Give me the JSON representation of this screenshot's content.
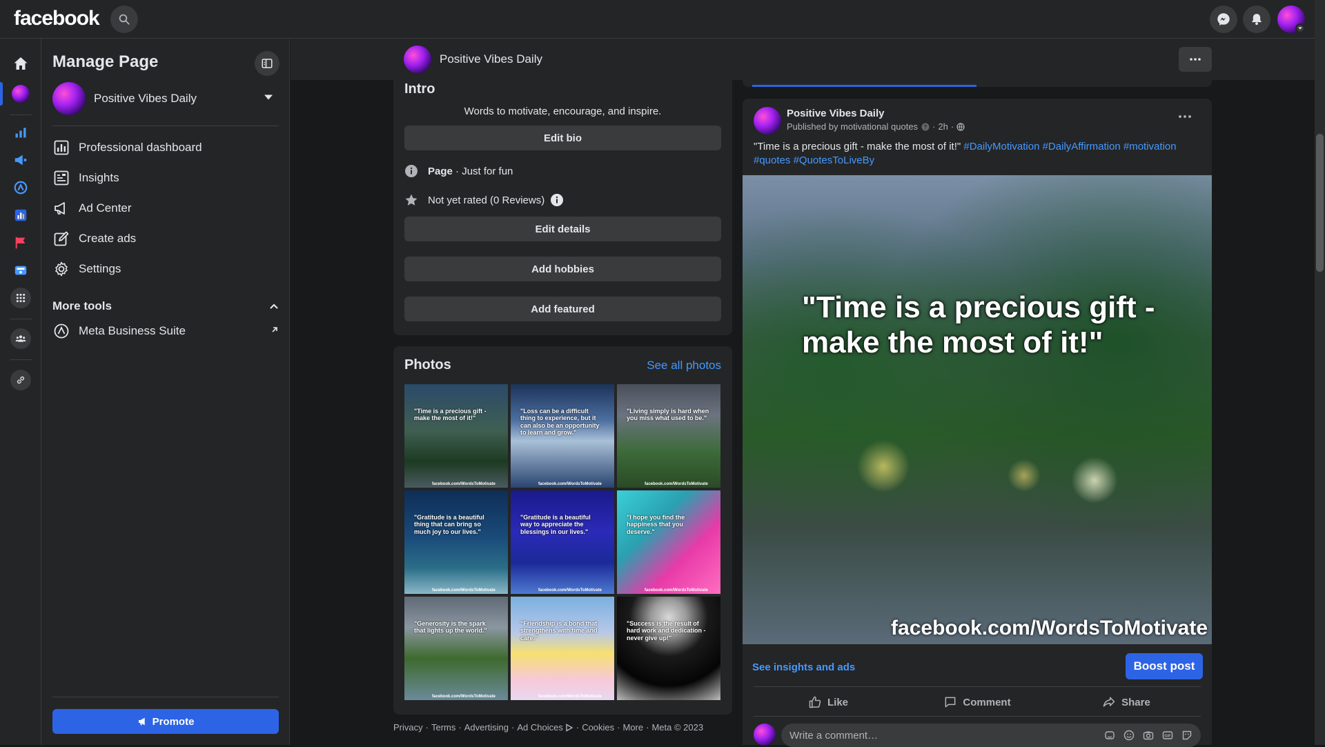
{
  "topbar": {
    "logo": "facebook",
    "icons": [
      "search-icon",
      "messenger-icon",
      "bell-icon",
      "account-avatar"
    ]
  },
  "rail": {
    "icons": [
      "home-icon",
      "page-avatar",
      "bar-chart-icon",
      "megaphone-icon",
      "meta-suite-icon",
      "analytics-icon",
      "flag-icon",
      "ads-manager-icon",
      "apps-grid-icon",
      "groups-icon",
      "link-icon"
    ]
  },
  "left_panel": {
    "title": "Manage Page",
    "page_name": "Positive Vibes Daily",
    "menu": [
      {
        "label": "Professional dashboard",
        "icon": "dashboard-icon"
      },
      {
        "label": "Insights",
        "icon": "insights-icon"
      },
      {
        "label": "Ad Center",
        "icon": "megaphone-icon"
      },
      {
        "label": "Create ads",
        "icon": "pencil-icon"
      },
      {
        "label": "Settings",
        "icon": "gear-icon"
      }
    ],
    "more_tools_label": "More tools",
    "more_tools": [
      {
        "label": "Meta Business Suite",
        "icon": "meta-suite-icon"
      }
    ],
    "promote_label": "Promote"
  },
  "page_header": {
    "name": "Positive Vibes Daily",
    "more_label": "···"
  },
  "intro": {
    "title": "Intro",
    "bio": "Words to motivate, encourage, and inspire.",
    "edit_bio": "Edit bio",
    "category_bold": "Page",
    "category_rest": " · Just for fun",
    "rating": "Not yet rated (0 Reviews)",
    "edit_details": "Edit details",
    "add_hobbies": "Add hobbies",
    "add_featured": "Add featured"
  },
  "photos": {
    "title": "Photos",
    "see_all": "See all photos",
    "watermark": "facebook.com/WordsToMotivate",
    "items": [
      {
        "quote": "\"Time is a precious gift - make the most of it!\""
      },
      {
        "quote": "\"Loss can be a difficult thing to experience, but it can also be an opportunity to learn and grow.\""
      },
      {
        "quote": "\"Living simply is hard when you miss what used to be.\""
      },
      {
        "quote": "\"Gratitude is a beautiful thing that can bring so much joy to our lives.\""
      },
      {
        "quote": "\"Gratitude is a beautiful way to appreciate the blessings in our lives.\""
      },
      {
        "quote": "\"I hope you find the happiness that you deserve.\""
      },
      {
        "quote": "\"Generosity is the spark that lights up the world.\""
      },
      {
        "quote": "\"Friendship is a bond that strengthens with time and care.\""
      },
      {
        "quote": "\"Success is the result of hard work and dedication - never give up!\""
      }
    ]
  },
  "footer": {
    "links": [
      "Privacy",
      "Terms",
      "Advertising",
      "Ad Choices",
      "Cookies",
      "More"
    ],
    "copyright": "Meta © 2023"
  },
  "post": {
    "author": "Positive Vibes Daily",
    "published_by": "Published by motivational quotes",
    "time": "2h",
    "text": "\"Time is a precious gift - make the most of it!\"",
    "hashtags": [
      "#DailyMotivation",
      "#DailyAffirmation",
      "#motivation",
      "#quotes",
      "#QuotesToLiveBy"
    ],
    "image_quote": "\"Time is a precious gift - make the most of it!\"",
    "image_watermark": "facebook.com/WordsToMotivate",
    "insights_link": "See insights and ads",
    "boost_label": "Boost post",
    "actions": {
      "like": "Like",
      "comment": "Comment",
      "share": "Share"
    },
    "comment_placeholder": "Write a comment…"
  },
  "colors": {
    "accent": "#2d64e6",
    "link": "#4599ff",
    "surface": "#242526",
    "background": "#18191a"
  }
}
